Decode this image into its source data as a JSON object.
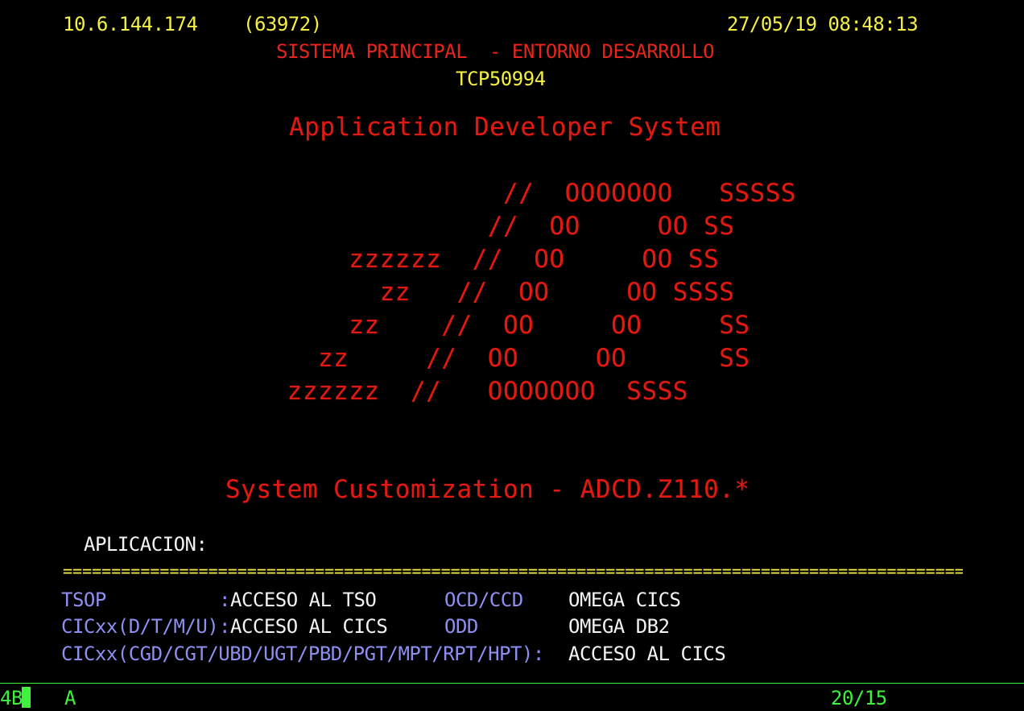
{
  "header": {
    "ip_address": "10.6.144.174",
    "port": "(63972)",
    "datetime": "27/05/19 08:48:13",
    "system_title": "SISTEMA PRINCIPAL  - ENTORNO DESARROLLO",
    "terminal_id": "TCP50994"
  },
  "banner": {
    "title": "Application Developer System",
    "logo_lines": [
      "                  //  OOOOOOO   SSSSS",
      "                 //  OO     OO SS",
      "        zzzzzz  //  OO     OO SS",
      "          zz   //  OO     OO SSSS",
      "        zz    //  OO     OO     SS",
      "      zz     //  OO     OO      SS",
      "    zzzzzz  //   OOOOOOO  SSSS"
    ],
    "customization": "System Customization - ADCD.Z110.*"
  },
  "prompt": {
    "label": "APLICACION:",
    "value": ""
  },
  "divider": "=================================================================================================================",
  "menu": {
    "rows": [
      {
        "code": "TSOP          ",
        "sep": ":",
        "desc": "ACCESO AL TSO",
        "code2": "OCD/CCD",
        "desc2": "OMEGA CICS"
      },
      {
        "code": "CICxx(D/T/M/U)",
        "sep": ":",
        "desc": "ACCESO AL CICS",
        "code2": "ODD",
        "desc2": "OMEGA DB2"
      }
    ],
    "long_row": {
      "code": "CICxx(CGD/CGT/UBD/UGT/PBD/PGT/MPT/RPT/HPT):",
      "desc": "ACCESO AL CICS"
    }
  },
  "status_bar": {
    "session": "4B",
    "mode": "A",
    "cursor_position": "20/15"
  },
  "colors": {
    "background": "#000000",
    "yellow": "#f5f046",
    "red": "#e8241c",
    "white": "#f4f4f4",
    "blue": "#8f8ff2",
    "green": "#3ef23e"
  }
}
